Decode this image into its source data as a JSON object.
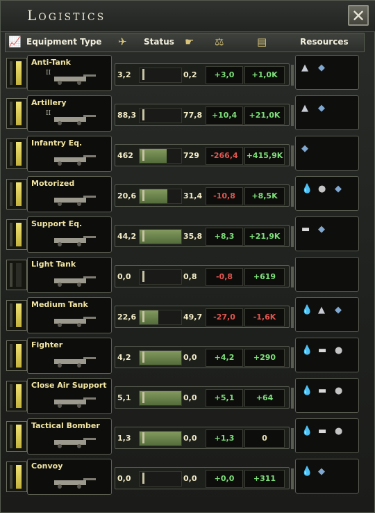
{
  "title": "Logistics",
  "close_icon": "close-x-icon",
  "header": {
    "equipment_type": "Equipment Type",
    "status": "Status",
    "resources": "Resources",
    "icons": [
      "chart-icon",
      "plane-icon",
      "hand-icon",
      "scales-icon",
      "building-icon"
    ]
  },
  "rows": [
    {
      "name": "Anti-Tank",
      "tier": "II",
      "produced": "3,2",
      "fill": 0.0,
      "in_field": "0,2",
      "delta": "+3,0",
      "delta_sign": "pos",
      "stock": "+1,0K",
      "stock_sign": "pos",
      "resources": [
        "tungsten",
        "steel"
      ],
      "active": true
    },
    {
      "name": "Artillery",
      "tier": "II",
      "produced": "88,3",
      "fill": 0.0,
      "in_field": "77,8",
      "delta": "+10,4",
      "delta_sign": "pos",
      "stock": "+21,0K",
      "stock_sign": "pos",
      "resources": [
        "tungsten",
        "steel"
      ],
      "active": true
    },
    {
      "name": "Infantry Eq.",
      "tier": "",
      "produced": "462",
      "fill": 0.65,
      "in_field": "729",
      "delta": "-266,4",
      "delta_sign": "neg",
      "stock": "+415,9K",
      "stock_sign": "pos",
      "resources": [
        "steel"
      ],
      "active": true
    },
    {
      "name": "Motorized",
      "tier": "",
      "produced": "20,6",
      "fill": 0.66,
      "in_field": "31,4",
      "delta": "-10,8",
      "delta_sign": "neg",
      "stock": "+8,5K",
      "stock_sign": "pos",
      "resources": [
        "oil",
        "rubber",
        "steel"
      ],
      "active": true
    },
    {
      "name": "Support Eq.",
      "tier": "",
      "produced": "44,2",
      "fill": 1.0,
      "in_field": "35,8",
      "delta": "+8,3",
      "delta_sign": "pos",
      "stock": "+21,9K",
      "stock_sign": "pos",
      "resources": [
        "aluminium",
        "steel"
      ],
      "active": true
    },
    {
      "name": "Light Tank",
      "tier": "",
      "produced": "0,0",
      "fill": 0.0,
      "in_field": "0,8",
      "delta": "-0,8",
      "delta_sign": "neg",
      "stock": "+619",
      "stock_sign": "pos",
      "resources": [],
      "active": false
    },
    {
      "name": "Medium Tank",
      "tier": "",
      "produced": "22,6",
      "fill": 0.45,
      "in_field": "49,7",
      "delta": "-27,0",
      "delta_sign": "neg",
      "stock": "-1,6K",
      "stock_sign": "neg",
      "resources": [
        "oil",
        "tungsten",
        "steel"
      ],
      "active": true
    },
    {
      "name": "Fighter",
      "tier": "",
      "produced": "4,2",
      "fill": 1.0,
      "in_field": "0,0",
      "delta": "+4,2",
      "delta_sign": "pos",
      "stock": "+290",
      "stock_sign": "pos",
      "resources": [
        "oil",
        "aluminium",
        "rubber"
      ],
      "active": true
    },
    {
      "name": "Close Air Support",
      "tier": "",
      "produced": "5,1",
      "fill": 1.0,
      "in_field": "0,0",
      "delta": "+5,1",
      "delta_sign": "pos",
      "stock": "+64",
      "stock_sign": "pos",
      "resources": [
        "oil",
        "aluminium",
        "rubber"
      ],
      "active": true
    },
    {
      "name": "Tactical Bomber",
      "tier": "",
      "produced": "1,3",
      "fill": 1.0,
      "in_field": "0,0",
      "delta": "+1,3",
      "delta_sign": "pos",
      "stock": "0",
      "stock_sign": "neu",
      "resources": [
        "oil",
        "aluminium",
        "rubber"
      ],
      "active": true
    },
    {
      "name": "Convoy",
      "tier": "",
      "produced": "0,0",
      "fill": 0.0,
      "in_field": "0,0",
      "delta": "+0,0",
      "delta_sign": "pos",
      "stock": "+311",
      "stock_sign": "pos",
      "resources": [
        "oil",
        "steel"
      ],
      "active": true
    }
  ],
  "colors": {
    "positive": "#7ee07a",
    "negative": "#e35650",
    "label": "#f3e6a3",
    "bar": "#e6d65a"
  }
}
